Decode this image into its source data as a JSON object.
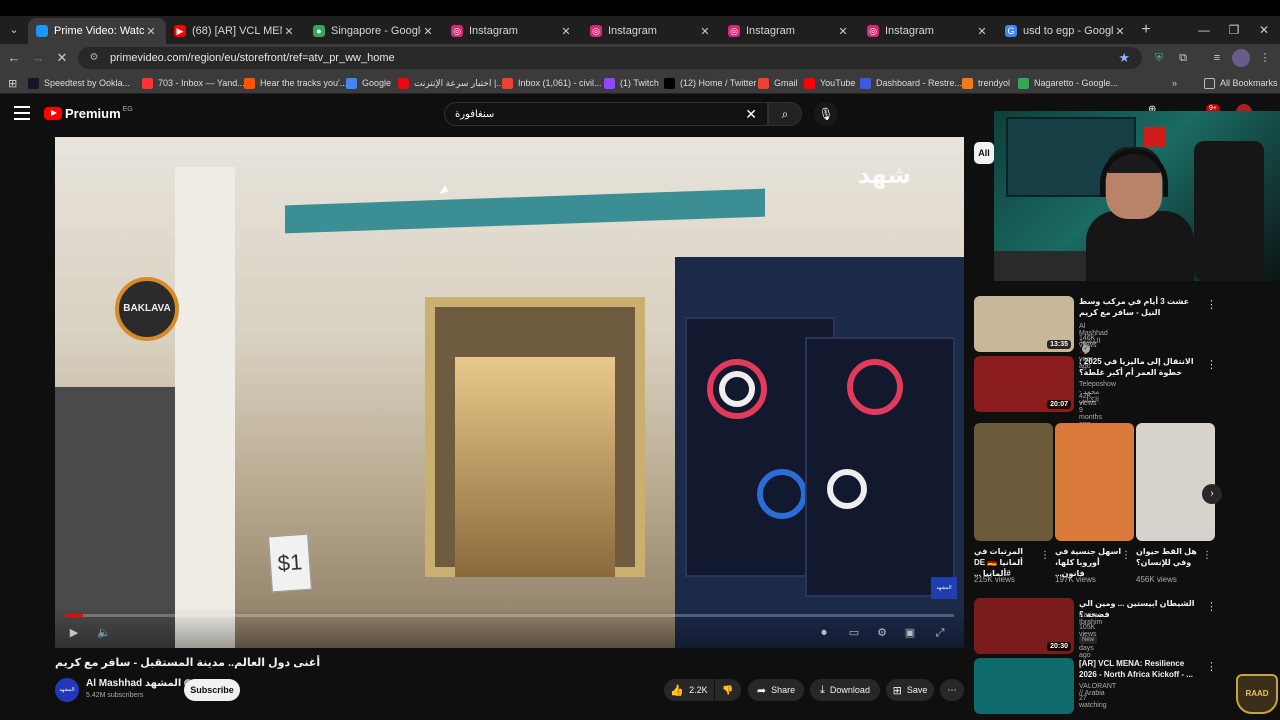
{
  "browser": {
    "tabs": [
      {
        "title": "Prime Video: Watch movi",
        "fav": "",
        "color": "#1a98ff",
        "active": true
      },
      {
        "title": "(68) [AR] VCL MENA: Resi",
        "fav": "▶",
        "color": "#ff0000",
        "active": false
      },
      {
        "title": "Singapore - Google Maps",
        "fav": "●",
        "color": "#34a853",
        "active": false
      },
      {
        "title": "Instagram",
        "fav": "◎",
        "color": "#d62976",
        "active": false
      },
      {
        "title": "Instagram",
        "fav": "◎",
        "color": "#d62976",
        "active": false
      },
      {
        "title": "Instagram",
        "fav": "◎",
        "color": "#d62976",
        "active": false
      },
      {
        "title": "Instagram",
        "fav": "◎",
        "color": "#d62976",
        "active": false
      },
      {
        "title": "usd to egp - Google Sear",
        "fav": "G",
        "color": "#4285f4",
        "active": false
      }
    ],
    "new_tab": "+",
    "url": "primevideo.com/region/eu/storefront/ref=atv_pr_ww_home",
    "bookmarks": [
      {
        "label": "Speedtest by Ookla...",
        "color": "#141526"
      },
      {
        "label": "703 - Inbox — Yand...",
        "color": "#ff3333"
      },
      {
        "label": "Hear the tracks you'...",
        "color": "#ff5500"
      },
      {
        "label": "Google",
        "color": "#4285f4"
      },
      {
        "label": "اختبار سرعة الإنترنت |...",
        "color": "#e50914"
      },
      {
        "label": "Inbox (1,061) - civil...",
        "color": "#ea4335"
      },
      {
        "label": "(1) Twitch",
        "color": "#9146ff"
      },
      {
        "label": "(12) Home / Twitter",
        "color": "#000000"
      },
      {
        "label": "Gmail",
        "color": "#ea4335"
      },
      {
        "label": "YouTube",
        "color": "#ff0000"
      },
      {
        "label": "Dashboard - Restre...",
        "color": "#3b5bdb"
      },
      {
        "label": "trendyol",
        "color": "#f27a1a"
      },
      {
        "label": "Nagaretto - Google...",
        "color": "#34a853"
      }
    ],
    "all_bookmarks": "All Bookmarks"
  },
  "youtube": {
    "logo_text": "Premium",
    "logo_region": "EG",
    "search_value": "سنغافورة",
    "video": {
      "title": "أغنى دول العالم.. مدينة المستقبل - سافر مع كريم",
      "sign_text": "BAKLAVA",
      "watermark": "شهد",
      "badge": "المشهد",
      "dollar": "$1",
      "progress_fraction": 0.02
    },
    "channel": {
      "avatar": "المشهد",
      "name": "Al Mashhad المشهد",
      "subs": "5.42M subscribers",
      "subscribe": "Subscribe"
    },
    "actions": {
      "like": "2.2K",
      "share": "Share",
      "download": "Download",
      "save": "Save"
    },
    "chip_all": "All",
    "recs": [
      {
        "title": "عشت 3 أيام في مركب وسط النيل - سافر مع كريم",
        "channel": "Al Mashhad المشهد",
        "meta": "146K views · 1 year ago",
        "duration": "13:35",
        "thumb": "#c9b79a",
        "verified": true
      },
      {
        "title": "الانتقال إلى ماليزيا في 2025 : خطوة العمر أم أكبر غلطة؟",
        "channel": "Teleposhow - محمد الكناني",
        "meta": "42K views · 9 months ago",
        "duration": "20:07",
        "thumb": "#8b1d1d",
        "verified": false
      }
    ],
    "shorts": [
      {
        "title": "المرتبات في ألمانيا DE 🇩🇪 #ألمانيا ...",
        "views": "215K views",
        "thumb": "#6b5b3a"
      },
      {
        "title": "اسهل جنسية في أوروبا كلها، فانون...",
        "views": "197K views",
        "thumb": "#d9793a"
      },
      {
        "title": "هل القط حيوان وفي للإنسان؟",
        "views": "456K views",
        "thumb": "#d8d2cc"
      }
    ],
    "recs2": [
      {
        "title": "الشيطان ابيستين ... ومين الي فضحه ؟",
        "channel": "Karim Ibrahim",
        "meta": "105K views · 3 days ago",
        "badge": "New",
        "duration": "20:30",
        "thumb": "#7a1c1c"
      },
      {
        "title": "[AR] VCL MENA: Resilience 2026 - North Africa Kickoff - ...",
        "channel": "VALORANT // Arabia",
        "meta": "27 watching",
        "thumb": "#0f6b6b"
      }
    ],
    "webcam_overlay": "RAAD"
  }
}
